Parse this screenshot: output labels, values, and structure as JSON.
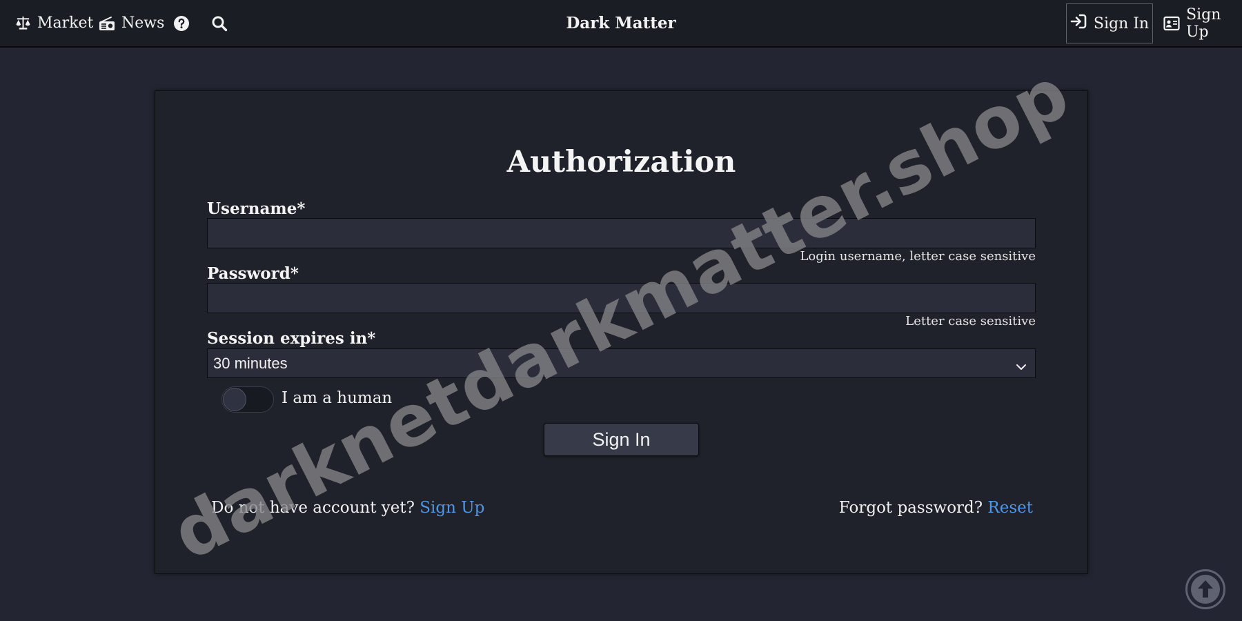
{
  "navbar": {
    "market_label": "Market",
    "news_label": "News",
    "brand": "Dark Matter",
    "signin_label": "Sign In",
    "signup_label": "Sign Up"
  },
  "form": {
    "title": "Authorization",
    "username_label": "Username*",
    "username_value": "",
    "username_hint": "Login username, letter case sensitive",
    "password_label": "Password*",
    "password_value": "",
    "password_hint": "Letter case sensitive",
    "session_label": "Session expires in*",
    "session_value": "30 minutes",
    "human_label": "I am a human",
    "human_checked": false,
    "submit_label": "Sign In"
  },
  "footer_links": {
    "signup_prompt": "Do not have account yet?",
    "signup_link": "Sign Up",
    "forgot_prompt": "Forgot password?",
    "reset_link": "Reset"
  },
  "watermark": "darknetdarkmatter.shop",
  "icons": {
    "market": "scale-balance-icon",
    "news": "radio-icon",
    "help": "question-circle-icon",
    "search": "search-icon",
    "signin": "sign-in-arrow-icon",
    "signup": "id-card-icon",
    "select": "chevron-down-icon",
    "scroll_top": "arrow-up-circle-icon"
  },
  "colors": {
    "background": "#232632",
    "navbar": "#1b1d24",
    "card": "#20222b",
    "input": "#2b2e3a",
    "button": "#373a49",
    "link": "#4e97e8"
  }
}
